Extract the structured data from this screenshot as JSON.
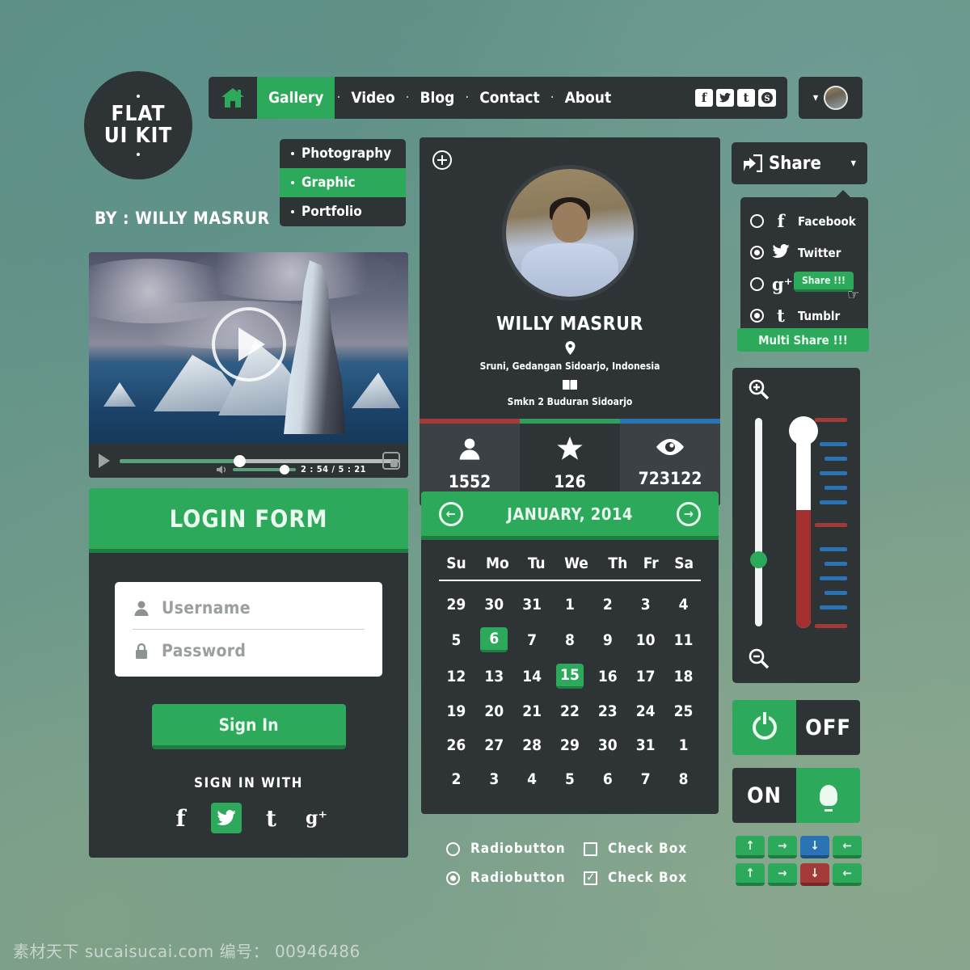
{
  "brand": {
    "logo_line1": "FLAT",
    "logo_line2": "UI KIT",
    "byline": "BY : WILLY MASRUR"
  },
  "nav": {
    "home_icon": "home-icon",
    "items": [
      {
        "label": "Gallery",
        "active": true
      },
      {
        "label": "Video",
        "active": false
      },
      {
        "label": "Blog",
        "active": false
      },
      {
        "label": "Contact",
        "active": false
      },
      {
        "label": "About",
        "active": false
      }
    ],
    "separator": "·",
    "socials": [
      {
        "name": "facebook-icon",
        "glyph": "f"
      },
      {
        "name": "twitter-icon",
        "glyph": "🐦"
      },
      {
        "name": "tumblr-icon",
        "glyph": "t"
      },
      {
        "name": "skype-icon",
        "glyph": "S"
      }
    ],
    "account_caret": "▾"
  },
  "dropdown": {
    "items": [
      {
        "label": "Photography",
        "active": false
      },
      {
        "label": "Graphic",
        "active": true
      },
      {
        "label": "Portfolio",
        "active": false
      }
    ]
  },
  "video": {
    "play_label": "play-button",
    "current_time": "2 : 54",
    "separator": "/",
    "total_time": "5 : 21",
    "time_display": "2 : 54 / 5 : 21",
    "progress_percent": 43,
    "volume_percent": 88
  },
  "login": {
    "title": "LOGIN FORM",
    "username_placeholder": "Username",
    "password_placeholder": "Password",
    "username_value": "",
    "password_value": "",
    "signin_label": "Sign In",
    "sign_in_with": "SIGN IN WITH",
    "socials": [
      {
        "name": "facebook-icon",
        "glyph": "f",
        "active": false
      },
      {
        "name": "twitter-icon",
        "glyph": "🐦",
        "active": true
      },
      {
        "name": "tumblr-icon",
        "glyph": "t",
        "active": false
      },
      {
        "name": "googleplus-icon",
        "glyph": "g⁺",
        "active": false
      }
    ]
  },
  "profile": {
    "add_icon": "plus-circle-icon",
    "name": "WILLY MASRUR",
    "location_icon": "map-pin-icon",
    "location": "Sruni, Gedangan Sidoarjo, Indonesia",
    "education_icon": "book-icon",
    "education": "Smkn 2 Buduran Sidoarjo",
    "bar_colors": [
      "#a33a3a",
      "#2f9d5b",
      "#2a73b5"
    ],
    "stats": [
      {
        "icon": "user-icon",
        "glyph": "👤",
        "value": "1552"
      },
      {
        "icon": "star-icon",
        "glyph": "★",
        "value": "126"
      },
      {
        "icon": "eye-icon",
        "glyph": "👁",
        "value": "723122"
      }
    ]
  },
  "calendar": {
    "prev_label": "←",
    "next_label": "→",
    "month_year": "JANUARY, 2014",
    "weekdays": [
      "Su",
      "Mo",
      "Tu",
      "We",
      "Th",
      "Fr",
      "Sa"
    ],
    "weeks": [
      [
        {
          "d": "29"
        },
        {
          "d": "30"
        },
        {
          "d": "31"
        },
        {
          "d": "1"
        },
        {
          "d": "2"
        },
        {
          "d": "3"
        },
        {
          "d": "4"
        }
      ],
      [
        {
          "d": "5"
        },
        {
          "d": "6",
          "sel": true
        },
        {
          "d": "7"
        },
        {
          "d": "8"
        },
        {
          "d": "9"
        },
        {
          "d": "10"
        },
        {
          "d": "11"
        }
      ],
      [
        {
          "d": "12"
        },
        {
          "d": "13"
        },
        {
          "d": "14"
        },
        {
          "d": "15",
          "sel": true
        },
        {
          "d": "16"
        },
        {
          "d": "17"
        },
        {
          "d": "18"
        }
      ],
      [
        {
          "d": "19"
        },
        {
          "d": "20"
        },
        {
          "d": "21"
        },
        {
          "d": "22"
        },
        {
          "d": "23"
        },
        {
          "d": "24"
        },
        {
          "d": "25"
        }
      ],
      [
        {
          "d": "26"
        },
        {
          "d": "27"
        },
        {
          "d": "28"
        },
        {
          "d": "29"
        },
        {
          "d": "30"
        },
        {
          "d": "31"
        },
        {
          "d": "1"
        }
      ],
      [
        {
          "d": "2"
        },
        {
          "d": "3"
        },
        {
          "d": "4"
        },
        {
          "d": "5"
        },
        {
          "d": "6"
        },
        {
          "d": "7"
        },
        {
          "d": "8"
        }
      ]
    ]
  },
  "controls": {
    "radio1_label": "Radiobutton",
    "radio1_checked": false,
    "radio2_label": "Radiobutton",
    "radio2_checked": true,
    "check1_label": "Check Box",
    "check1_checked": false,
    "check2_label": "Check Box",
    "check2_checked": true
  },
  "share": {
    "button_label": "Share",
    "button_icon": "share-icon",
    "caret": "▾",
    "options": [
      {
        "name": "Facebook",
        "icon": "facebook-icon",
        "glyph": "f",
        "checked": false
      },
      {
        "name": "Twitter",
        "icon": "twitter-icon",
        "glyph": "🐦",
        "checked": true
      },
      {
        "name": "Google Plus",
        "icon": "googleplus-icon",
        "glyph": "g⁺",
        "checked": false
      },
      {
        "name": "Tumblr",
        "icon": "tumblr-icon",
        "glyph": "t",
        "checked": true
      }
    ],
    "tooltip_label": "Share !!!",
    "multi_share_label": "Multi Share !!!"
  },
  "slider": {
    "zoom_in_icon": "zoom-in-icon",
    "zoom_out_icon": "zoom-out-icon",
    "slider_percent": 36,
    "thermometer_percent": 56
  },
  "toggles": {
    "power_icon": "power-icon",
    "off_label": "OFF",
    "on_label": "ON",
    "bulb_icon": "lightbulb-icon"
  },
  "arrow_buttons": {
    "row1": [
      {
        "dir": "up",
        "glyph": "↑",
        "color": "g"
      },
      {
        "dir": "right",
        "glyph": "→",
        "color": "g"
      },
      {
        "dir": "down",
        "glyph": "↓",
        "color": "b"
      },
      {
        "dir": "left",
        "glyph": "←",
        "color": "g"
      }
    ],
    "row2": [
      {
        "dir": "up",
        "glyph": "↑",
        "color": "g"
      },
      {
        "dir": "right",
        "glyph": "→",
        "color": "g"
      },
      {
        "dir": "down",
        "glyph": "↓",
        "color": "r"
      },
      {
        "dir": "left",
        "glyph": "←",
        "color": "g"
      }
    ]
  },
  "watermark": {
    "text": "素材天下 sucaisucai.com  编号： 00946486"
  },
  "colors": {
    "accent_green": "#2ca95a",
    "accent_green_dark": "#1f7d42",
    "panel_dark": "#2e3335",
    "panel_dark_alt": "#3b4144",
    "red": "#a33a3a",
    "blue": "#2a73b5"
  }
}
